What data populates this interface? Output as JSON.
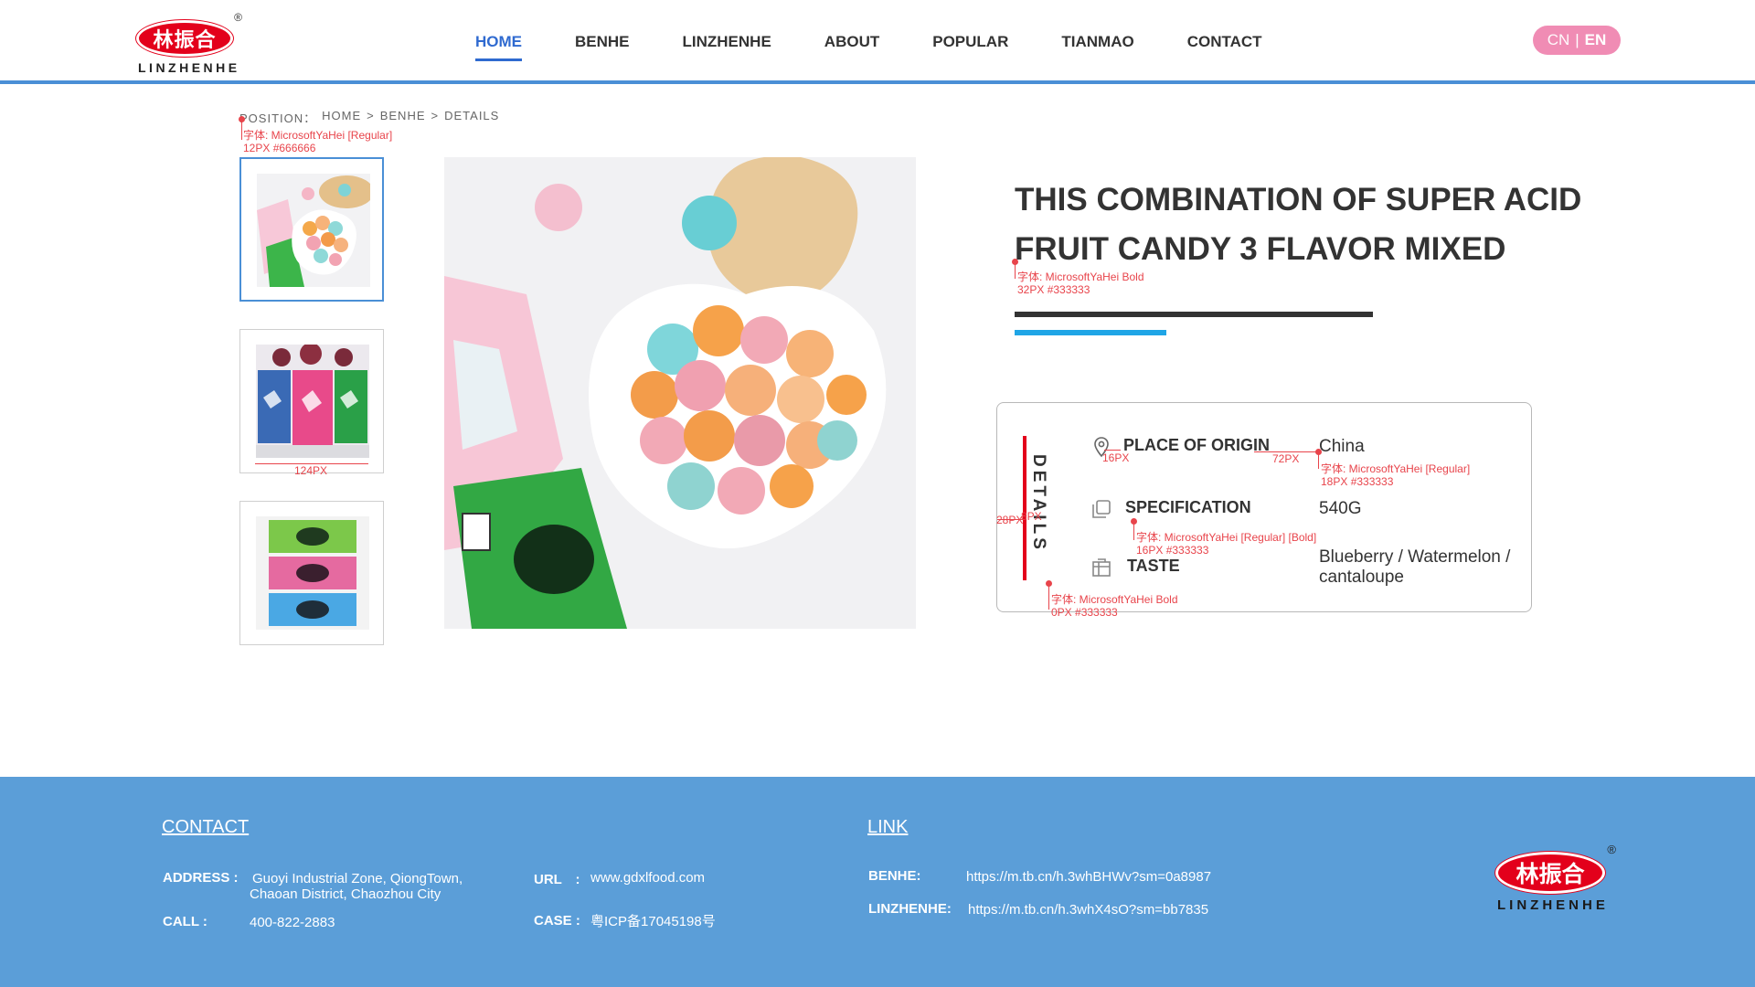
{
  "brand": {
    "logo_chinese": "林振合",
    "logo_text": "LINZHENHE",
    "registered_mark": "®",
    "primary_color": "#e3001b",
    "accent_color": "#2f6ad0"
  },
  "nav": {
    "items": [
      {
        "label": "HOME",
        "active": true
      },
      {
        "label": "BENHE"
      },
      {
        "label": "LINZHENHE"
      },
      {
        "label": "ABOUT"
      },
      {
        "label": "POPULAR"
      },
      {
        "label": "TIANMAO"
      },
      {
        "label": "CONTACT"
      }
    ]
  },
  "language": {
    "cn": "CN",
    "separator": "|",
    "en": "EN",
    "active": "EN"
  },
  "breadcrumb": {
    "prefix": "POSITION：",
    "items": [
      "HOME",
      "BENHE",
      "DETAILS"
    ],
    "separator": ">"
  },
  "annotations": {
    "breadcrumb_font": "字体: MicrosoftYaHei [Regular]",
    "breadcrumb_size": "12PX #666666",
    "thumb_width": "124PX",
    "title_font": "字体: MicrosoftYaHei Bold",
    "title_size": "32PX #333333",
    "gap_16": "16PX",
    "gap_72": "72PX",
    "value_font": "字体: MicrosoftYaHei [Regular]",
    "value_size": "18PX #333333",
    "label_font": "字体: MicrosoftYaHei [Regular] [Bold]",
    "label_size": "16PX #333333",
    "gap_28": "28PX",
    "gap_8": "8PX",
    "details_font": "字体: MicrosoftYaHei Bold",
    "details_size": "0PX #333333"
  },
  "product": {
    "title": "THIS COMBINATION OF SUPER ACID FRUIT CANDY 3 FLAVOR MIXED",
    "details_heading": "DETAILS",
    "rows": [
      {
        "icon": "location-pin-icon",
        "label": "PLACE OF ORIGIN",
        "value": "China"
      },
      {
        "icon": "layers-icon",
        "label": "SPECIFICATION",
        "value": "540G"
      },
      {
        "icon": "package-icon",
        "label": "TASTE",
        "value": "Blueberry / Watermelon / cantaloupe"
      }
    ]
  },
  "footer": {
    "contact_heading": "CONTACT",
    "link_heading": "LINK",
    "address_label": "ADDRESS :",
    "address_line1": "Guoyi Industrial Zone, QiongTown,",
    "address_line2": "Chaoan District, Chaozhou City",
    "call_label": "CALL :",
    "call_value": "400-822-2883",
    "url_label": "URL　:",
    "url_value": "www.gdxlfood.com",
    "case_label": "CASE :",
    "case_value": "粤ICP备17045198号",
    "benhe_label": "BENHE:",
    "benhe_url": "https://m.tb.cn/h.3whBHWv?sm=0a8987",
    "linzhenhe_label": "LINZHENHE:",
    "linzhenhe_url": "https://m.tb.cn/h.3whX4sO?sm=bb7835",
    "background_color": "#5b9ed8"
  }
}
